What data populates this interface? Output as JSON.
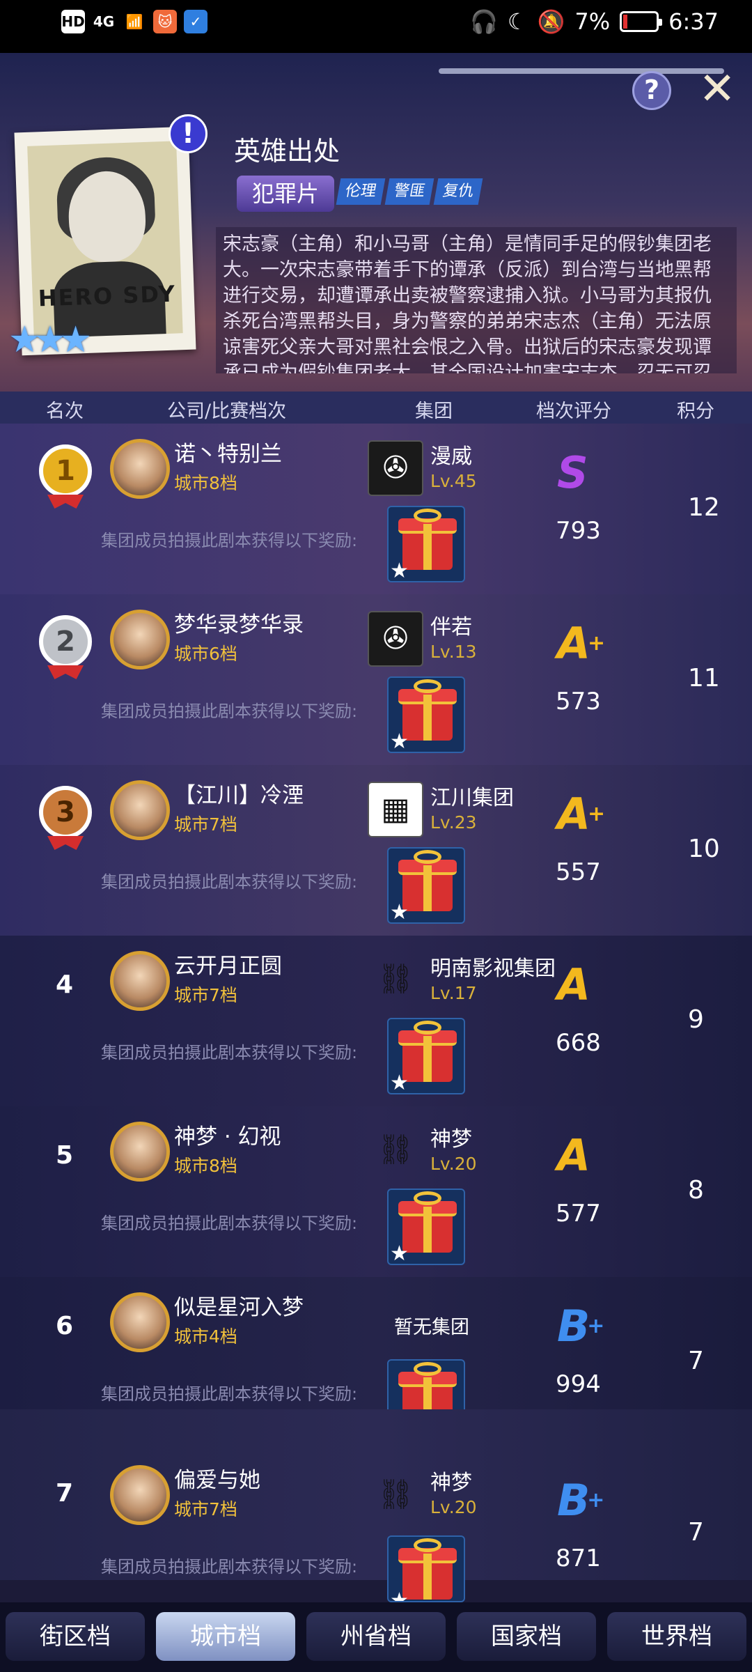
{
  "status_bar": {
    "left_icons": [
      "HD",
      "4G"
    ],
    "battery_percent": "7%",
    "time": "6:37"
  },
  "header": {
    "help_label": "?",
    "close_label": "✕",
    "alert_label": "!",
    "poster_title": "HERO SDY",
    "film_title": "英雄出处",
    "genre": "犯罪片",
    "tags": [
      "伦理",
      "警匪",
      "复仇"
    ],
    "synopsis": "宋志豪（主角）和小马哥（主角）是情同手足的假钞集团老大。一次宋志豪带着手下的谭承（反派）到台湾与当地黑帮进行交易，却遭谭承出卖被警察逮捕入狱。小马哥为其报仇杀死台湾黑帮头目，身为警察的弟弟宋志杰（主角）无法原谅害死父亲大哥对黑社会恨之入骨。出狱后的宋志豪发现谭承已成为假钞集团老大，其全国设计加害宋志杰，忍无可忍的宋志豪和"
  },
  "table": {
    "columns": [
      "名次",
      "公司/比赛档次",
      "集团",
      "档次评分",
      "积分"
    ],
    "reward_text": "集团成员拍摄此剧本获得以下奖励:",
    "no_group_text": "暂无集团",
    "rows": [
      {
        "rank": "1",
        "name": "诺丶特别兰",
        "city": "城市8档",
        "group": "漫威",
        "group_lv": "Lv.45",
        "grade": "S",
        "grade_plus": "",
        "score": "793",
        "points": "12"
      },
      {
        "rank": "2",
        "name": "梦华录梦华录",
        "city": "城市6档",
        "group": "伴若",
        "group_lv": "Lv.13",
        "grade": "A",
        "grade_plus": "+",
        "score": "573",
        "points": "11"
      },
      {
        "rank": "3",
        "name": "【江川】冷湮",
        "city": "城市7档",
        "group": "江川集团",
        "group_lv": "Lv.23",
        "grade": "A",
        "grade_plus": "+",
        "score": "557",
        "points": "10"
      },
      {
        "rank": "4",
        "name": "云开月正圆",
        "city": "城市7档",
        "group": "明南影视集团",
        "group_lv": "Lv.17",
        "grade": "A",
        "grade_plus": "",
        "score": "668",
        "points": "9"
      },
      {
        "rank": "5",
        "name": "神梦 · 幻视",
        "city": "城市8档",
        "group": "神梦",
        "group_lv": "Lv.20",
        "grade": "A",
        "grade_plus": "",
        "score": "577",
        "points": "8"
      },
      {
        "rank": "6",
        "name": "似是星河入梦",
        "city": "城市4档",
        "group": "",
        "group_lv": "",
        "grade": "B",
        "grade_plus": "+",
        "score": "994",
        "points": "7"
      },
      {
        "rank": "7",
        "name": "偏爱与她",
        "city": "城市7档",
        "group": "神梦",
        "group_lv": "Lv.20",
        "grade": "B",
        "grade_plus": "+",
        "score": "871",
        "points": "7"
      }
    ]
  },
  "tabs": [
    "街区档",
    "城市档",
    "州省档",
    "国家档",
    "世界档"
  ],
  "active_tab": "城市档",
  "colors": {
    "grade_S": "#b04ae8",
    "grade_A": "#f3b81e",
    "grade_B": "#3f8ef0",
    "city_text": "#f1c13b",
    "medal_gold": "#e7b020",
    "medal_silver": "#bfc2c8",
    "medal_bronze": "#c97a3a"
  }
}
